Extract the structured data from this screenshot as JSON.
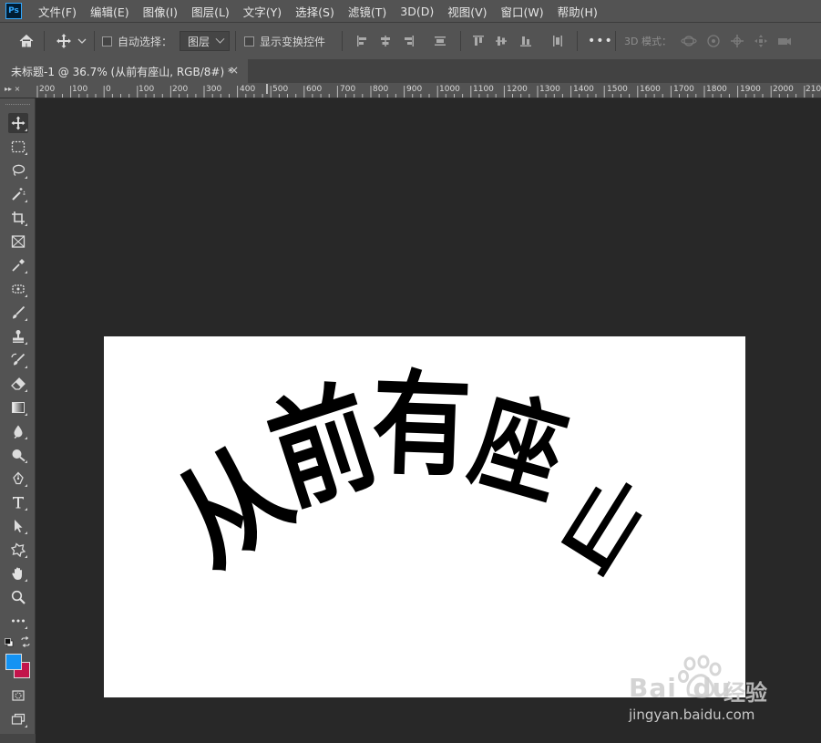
{
  "app": {
    "logo": "Ps"
  },
  "menu": [
    "文件(F)",
    "编辑(E)",
    "图像(I)",
    "图层(L)",
    "文字(Y)",
    "选择(S)",
    "滤镜(T)",
    "3D(D)",
    "视图(V)",
    "窗口(W)",
    "帮助(H)"
  ],
  "options": {
    "auto_select_label": "自动选择：",
    "auto_select_checked": false,
    "layer_select_value": "图层",
    "show_transform_label": "显示变换控件",
    "show_transform_checked": false,
    "more": "•••",
    "mode_3d_label": "3D 模式："
  },
  "document_tab": {
    "title": "未标题-1 @ 36.7% (从前有座山, RGB/8#) *",
    "close": "×"
  },
  "ruler": {
    "corner_glyphs": "▸▸ ×",
    "labels": [
      "200",
      "100",
      "0",
      "100",
      "200",
      "300",
      "400",
      "500",
      "600",
      "700",
      "800",
      "900",
      "1000",
      "1100",
      "1200",
      "1300",
      "1400",
      "1500",
      "1600",
      "1700",
      "1800",
      "1900",
      "2000",
      "210"
    ]
  },
  "tools": [
    "move-tool",
    "marquee-tool",
    "lasso-tool",
    "magic-wand-tool",
    "crop-tool",
    "frame-tool",
    "eyedropper-tool",
    "healing-tool",
    "brush-tool",
    "stamp-tool",
    "history-brush-tool",
    "eraser-tool",
    "gradient-tool",
    "blur-tool",
    "dodge-tool",
    "pen-tool",
    "type-tool",
    "path-select-tool",
    "shape-tool",
    "hand-tool",
    "zoom-tool",
    "edit-toolbar-tool"
  ],
  "colors": {
    "foreground": "#1493f3",
    "background": "#c3144b",
    "canvas": "#ffffff",
    "workspace": "#282828"
  },
  "canvas": {
    "text": "从前有座山",
    "characters": [
      "从",
      "前",
      "有",
      "座",
      "山"
    ]
  },
  "watermark": {
    "brand": "Bai",
    "brand_suffix": "du",
    "cn": "经验",
    "domain": "jingyan.baidu.com"
  }
}
